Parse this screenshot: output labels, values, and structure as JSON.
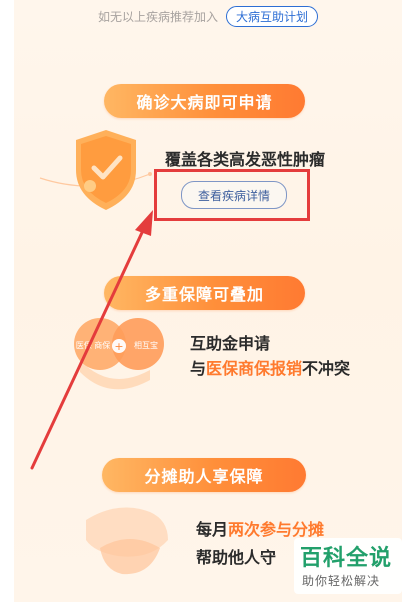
{
  "top_note": {
    "text": "如无以上疾病推荐加入",
    "pill_label": "大病互助计划"
  },
  "section1": {
    "banner": "确诊大病即可申请",
    "title": "覆盖各类高发恶性肿瘤",
    "button_label": "查看疾病详情"
  },
  "section2": {
    "banner": "多重保障可叠加",
    "illustration_left": "医保 商保",
    "illustration_plus": "+",
    "illustration_right": "相互宝",
    "line1": "互助金申请",
    "line2_prefix": "与",
    "line2_highlight": "医保商保报销",
    "line2_suffix": "不冲突"
  },
  "section3": {
    "banner": "分摊助人享保障",
    "line1_prefix": "每月",
    "line1_highlight": "两次参与分摊",
    "line2": "帮助他人守"
  },
  "watermark": {
    "big": "百科全说",
    "small": "助你轻松解决"
  },
  "colors": {
    "accent": "#ff7a2e",
    "banner_start": "#ffb763",
    "banner_end": "#ff7a32",
    "link_blue": "#2d6ed4",
    "annotation_red": "#e43c3c",
    "watermark_green": "#22a06b"
  }
}
